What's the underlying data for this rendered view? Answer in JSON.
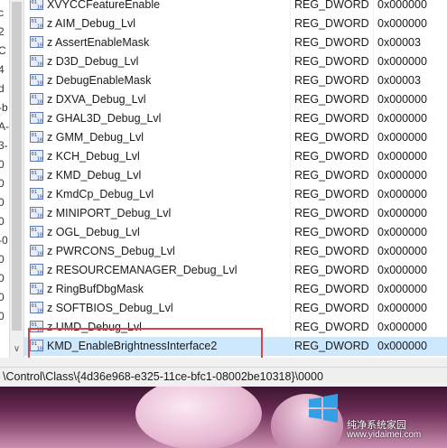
{
  "tree_fragments": [
    "c",
    "2",
    "C",
    "4",
    "d",
    "-b",
    "A-",
    "3-",
    "0",
    "0",
    "0",
    "0",
    "-0",
    "0",
    "0",
    "0",
    "0"
  ],
  "list": {
    "rows": [
      {
        "name": "XVYCCFeatureEnable",
        "type": "REG_DWORD",
        "data": "0x000000"
      },
      {
        "name": "z AIM_Debug_Lvl",
        "type": "REG_DWORD",
        "data": "0x000000"
      },
      {
        "name": "z AssertEnableMask",
        "type": "REG_DWORD",
        "data": "0x00003"
      },
      {
        "name": "z D3D_Debug_Lvl",
        "type": "REG_DWORD",
        "data": "0x000000"
      },
      {
        "name": "z DebugEnableMask",
        "type": "REG_DWORD",
        "data": "0x00003"
      },
      {
        "name": "z DXVA_Debug_Lvl",
        "type": "REG_DWORD",
        "data": "0x000000"
      },
      {
        "name": "z GHAL3D_Debug_Lvl",
        "type": "REG_DWORD",
        "data": "0x000000"
      },
      {
        "name": "z GMM_Debug_Lvl",
        "type": "REG_DWORD",
        "data": "0x000000"
      },
      {
        "name": "z KCH_Debug_Lvl",
        "type": "REG_DWORD",
        "data": "0x000000"
      },
      {
        "name": "z KMD_Debug_Lvl",
        "type": "REG_DWORD",
        "data": "0x000000"
      },
      {
        "name": "z KmdCp_Debug_Lvl",
        "type": "REG_DWORD",
        "data": "0x000000"
      },
      {
        "name": "z MINIPORT_Debug_Lvl",
        "type": "REG_DWORD",
        "data": "0x000000"
      },
      {
        "name": "z OGL_Debug_Lvl",
        "type": "REG_DWORD",
        "data": "0x000000"
      },
      {
        "name": "z PWRCONS_Debug_Lvl",
        "type": "REG_DWORD",
        "data": "0x000000"
      },
      {
        "name": "z RESOURCEMANAGER_Debug_Lvl",
        "type": "REG_DWORD",
        "data": "0x000000"
      },
      {
        "name": "z RingBufDbgMask",
        "type": "REG_DWORD",
        "data": "0x000000"
      },
      {
        "name": "z SOFTBIOS_Debug_Lvl",
        "type": "REG_DWORD",
        "data": "0x000000"
      },
      {
        "name": "z UMD_Debug_Lvl",
        "type": "REG_DWORD",
        "data": "0x000000"
      },
      {
        "name": "KMD_EnableBrightnessInterface2",
        "type": "REG_DWORD",
        "data": "0x000000"
      }
    ],
    "selected_index": 18
  },
  "status_bar": {
    "path": "\\Control\\Class\\{4d36e968-e325-11ce-bfc1-08002be10318}\\0000"
  },
  "watermark": {
    "text": "纯净系统家园",
    "url": "www.yidaimei.com"
  },
  "colors": {
    "selection": "#cce8ff",
    "highlight_box": "#d9434a"
  },
  "icons": {
    "value_icon": "registry-dword-icon"
  }
}
